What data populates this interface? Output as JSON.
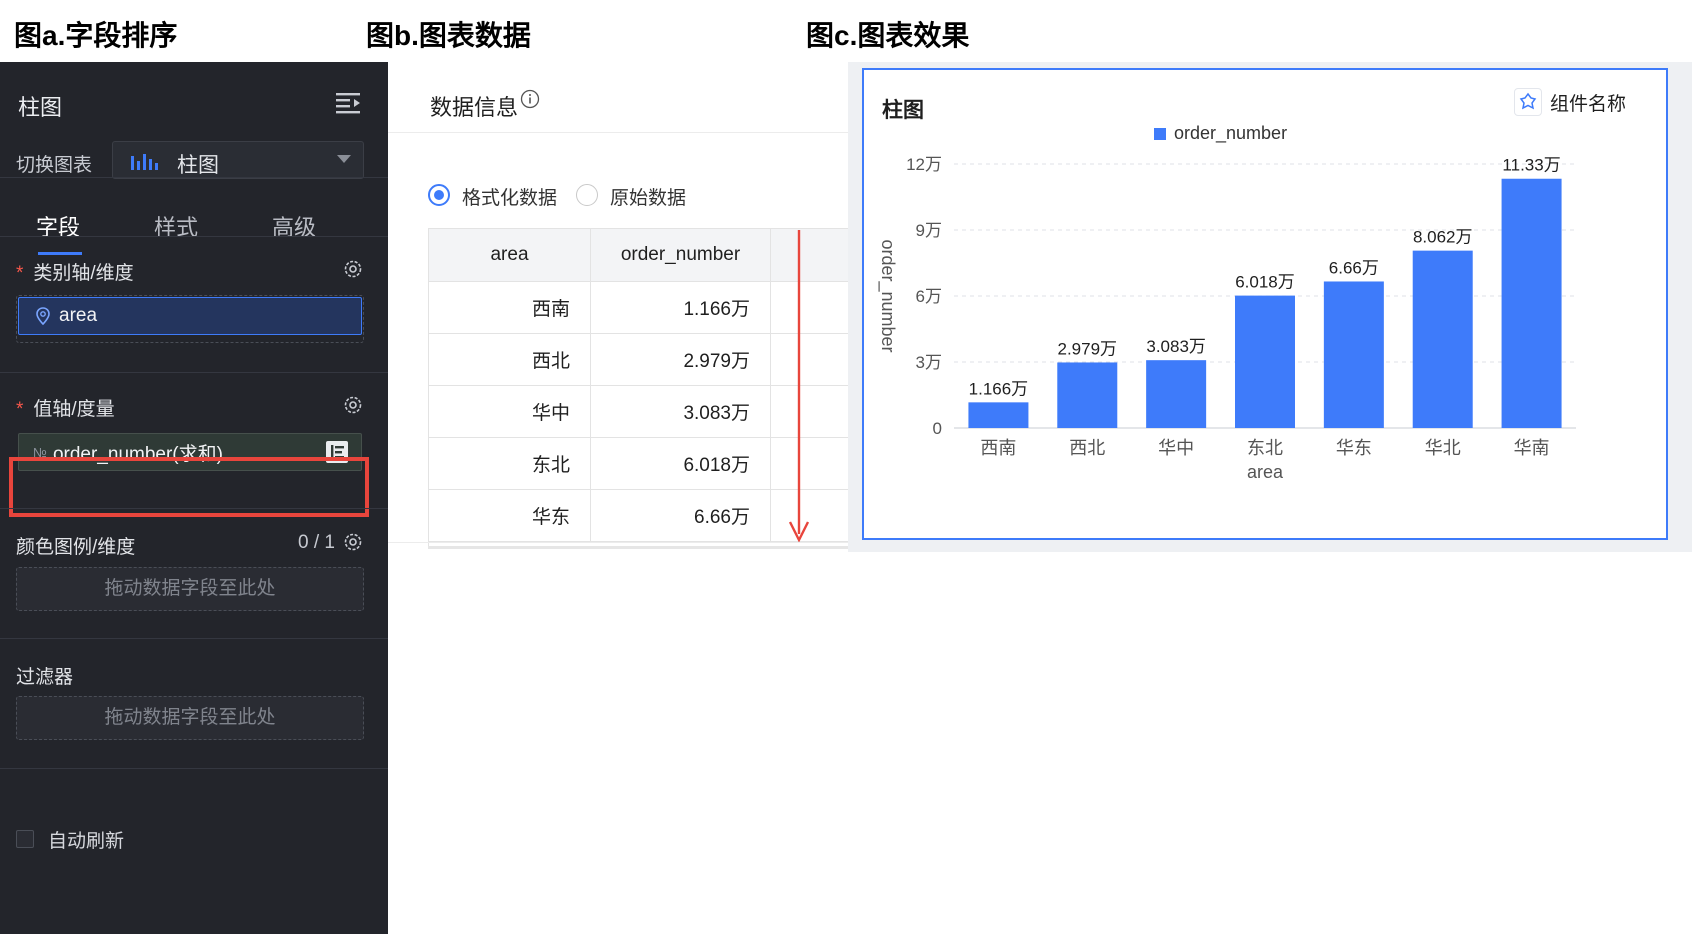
{
  "figures": {
    "a": "图a.字段排序",
    "b": "图b.图表数据",
    "c": "图c.图表效果"
  },
  "panel_a": {
    "header": "柱图",
    "switch_label": "切换图表",
    "switch_value": "柱图",
    "tabs": [
      "字段",
      "样式",
      "高级"
    ],
    "active_tab": "字段",
    "category_section": {
      "required": "*",
      "label": "类别轴/维度",
      "field": "area"
    },
    "value_section": {
      "required": "*",
      "label": "值轴/度量",
      "field_prefix": "№",
      "field": "order_number(求和)"
    },
    "color_section": {
      "label": "颜色图例/维度",
      "count": "0 / 1",
      "placeholder": "拖动数据字段至此处"
    },
    "filter_section": {
      "label": "过滤器",
      "placeholder": "拖动数据字段至此处"
    },
    "auto_refresh": {
      "label": "自动刷新",
      "checked": false
    },
    "accent_color": "#3e7bfa",
    "highlight_color": "#e8453c"
  },
  "panel_b": {
    "title": "数据信息",
    "radio_options": [
      {
        "label": "格式化数据",
        "selected": true
      },
      {
        "label": "原始数据",
        "selected": false
      }
    ],
    "table": {
      "headers": [
        "area",
        "order_number"
      ],
      "rows": [
        [
          "西南",
          "1.166万"
        ],
        [
          "西北",
          "2.979万"
        ],
        [
          "华中",
          "3.083万"
        ],
        [
          "东北",
          "6.018万"
        ],
        [
          "华东",
          "6.66万"
        ]
      ]
    },
    "arrow_color": "#e8453c"
  },
  "panel_c": {
    "title": "柱图",
    "component_button": "组件名称",
    "chart_data": {
      "type": "bar",
      "legend": "order_number",
      "legend_position": "top-center",
      "xlabel": "area",
      "ylabel": "order_number",
      "categories": [
        "西南",
        "西北",
        "华中",
        "东北",
        "华东",
        "华北",
        "华南"
      ],
      "values": [
        1.166,
        2.979,
        3.083,
        6.018,
        6.66,
        8.062,
        11.33
      ],
      "value_labels": [
        "1.166万",
        "2.979万",
        "3.083万",
        "6.018万",
        "6.66万",
        "8.062万",
        "11.33万"
      ],
      "ylim": [
        0,
        12
      ],
      "yticks": [
        0,
        3,
        6,
        9,
        12
      ],
      "ytick_labels": [
        "0",
        "3万",
        "6万",
        "9万",
        "12万"
      ],
      "grid": true,
      "bar_color": "#3e7bfa"
    }
  }
}
